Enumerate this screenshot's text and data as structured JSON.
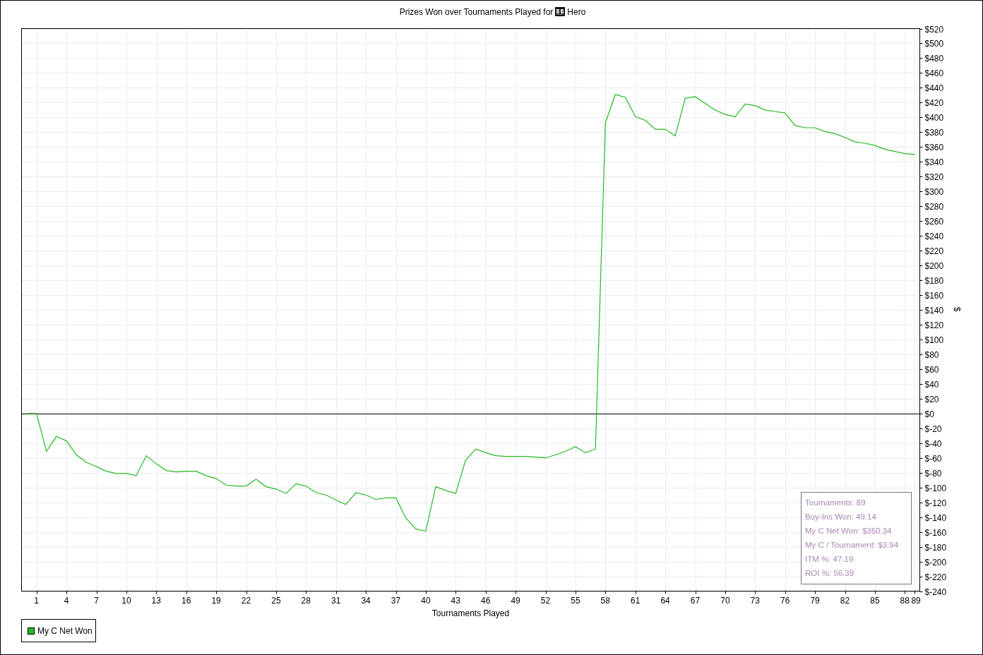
{
  "chart_data": {
    "type": "line",
    "title": "Prizes Won over Tournaments Played for",
    "xlabel": "Tournaments Played",
    "ylabel": "$",
    "x": [
      0,
      1,
      2,
      3,
      4,
      5,
      6,
      7,
      8,
      9,
      10,
      11,
      12,
      13,
      14,
      15,
      16,
      17,
      18,
      19,
      20,
      21,
      22,
      23,
      24,
      25,
      26,
      27,
      28,
      29,
      30,
      31,
      32,
      33,
      34,
      35,
      36,
      37,
      38,
      39,
      40,
      41,
      42,
      43,
      44,
      45,
      46,
      47,
      48,
      49,
      50,
      51,
      52,
      53,
      54,
      55,
      56,
      57,
      58,
      59,
      60,
      61,
      62,
      63,
      64,
      65,
      66,
      67,
      68,
      69,
      70,
      71,
      72,
      73,
      74,
      75,
      76,
      77,
      78,
      79,
      80,
      81,
      82,
      83,
      84,
      85,
      86,
      87,
      88,
      89
    ],
    "series": [
      {
        "name": "My C Net Won",
        "color": "#22bb22",
        "values": [
          0,
          0,
          -51,
          -31,
          -37,
          -56,
          -66,
          -72,
          -78,
          -81,
          -81,
          -84,
          -57,
          -68,
          -77,
          -79,
          -78,
          -78,
          -84,
          -88,
          -97,
          -98,
          -98,
          -89,
          -99,
          -102,
          -108,
          -95,
          -98,
          -107,
          -110,
          -117,
          -123,
          -107,
          -110,
          -116,
          -114,
          -114,
          -141,
          -156,
          -159,
          -99,
          -104,
          -108,
          -63,
          -48,
          -53,
          -57,
          -58,
          -58,
          -58,
          -59,
          -60,
          -56,
          -51,
          -45,
          -53,
          -48,
          393,
          431,
          427,
          401,
          396,
          384,
          384,
          375,
          426,
          428,
          419,
          410,
          404,
          401,
          418,
          416,
          410,
          408,
          406,
          389,
          386,
          386,
          381,
          378,
          373,
          367,
          365,
          362,
          357,
          354,
          351,
          350
        ]
      }
    ],
    "grid": true,
    "xlim": [
      -0.5,
      89.5
    ],
    "ylim": [
      -240,
      520
    ],
    "xticks": [
      1,
      4,
      7,
      10,
      13,
      16,
      19,
      22,
      25,
      28,
      31,
      34,
      37,
      40,
      43,
      46,
      49,
      52,
      55,
      58,
      61,
      64,
      67,
      70,
      73,
      76,
      79,
      82,
      85,
      88,
      89
    ],
    "yticks": [
      {
        "value": -240,
        "label": "$-240"
      },
      {
        "value": -220,
        "label": "$-220"
      },
      {
        "value": -200,
        "label": "$-200"
      },
      {
        "value": -180,
        "label": "$-180"
      },
      {
        "value": -160,
        "label": "$-160"
      },
      {
        "value": -140,
        "label": "$-140"
      },
      {
        "value": -120,
        "label": "$-120"
      },
      {
        "value": -100,
        "label": "$-100"
      },
      {
        "value": -80,
        "label": "$-80"
      },
      {
        "value": -60,
        "label": "$-60"
      },
      {
        "value": -40,
        "label": "$-40"
      },
      {
        "value": -20,
        "label": "$-20"
      },
      {
        "value": 0,
        "label": "$0"
      },
      {
        "value": 20,
        "label": "$20"
      },
      {
        "value": 40,
        "label": "$40"
      },
      {
        "value": 60,
        "label": "$60"
      },
      {
        "value": 80,
        "label": "$80"
      },
      {
        "value": 100,
        "label": "$100"
      },
      {
        "value": 120,
        "label": "$120"
      },
      {
        "value": 140,
        "label": "$140"
      },
      {
        "value": 160,
        "label": "$160"
      },
      {
        "value": 180,
        "label": "$180"
      },
      {
        "value": 200,
        "label": "$200"
      },
      {
        "value": 220,
        "label": "$220"
      },
      {
        "value": 240,
        "label": "$240"
      },
      {
        "value": 260,
        "label": "$260"
      },
      {
        "value": 280,
        "label": "$280"
      },
      {
        "value": 300,
        "label": "$300"
      },
      {
        "value": 320,
        "label": "$320"
      },
      {
        "value": 340,
        "label": "$340"
      },
      {
        "value": 360,
        "label": "$360"
      },
      {
        "value": 380,
        "label": "$380"
      },
      {
        "value": 400,
        "label": "$400"
      },
      {
        "value": 420,
        "label": "$420"
      },
      {
        "value": 440,
        "label": "$440"
      },
      {
        "value": 460,
        "label": "$460"
      },
      {
        "value": 480,
        "label": "$480"
      },
      {
        "value": 500,
        "label": "$500"
      },
      {
        "value": 520,
        "label": "$520"
      }
    ]
  },
  "player": "Hero",
  "stats": [
    "Tournaments: 89",
    "Buy-Ins Won: 49.14",
    "My C Net Won: $350.34",
    "My C / Tournament: $3.94",
    "ITM %: 47.19",
    "ROI %: 56.39"
  ]
}
